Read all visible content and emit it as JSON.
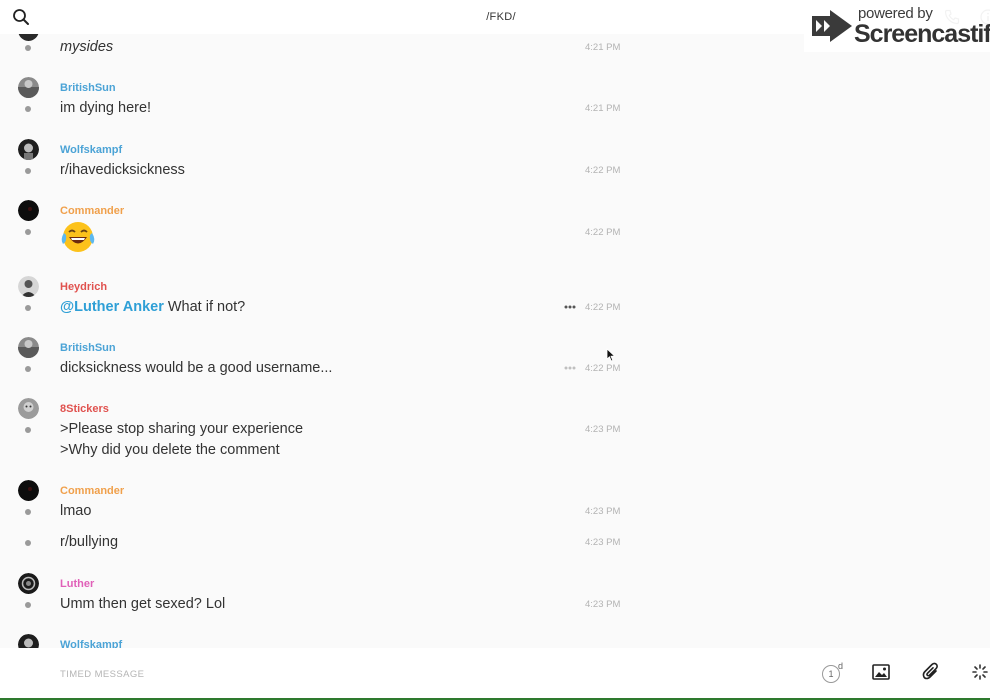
{
  "header": {
    "channel_title": "/FKD/"
  },
  "watermark": {
    "powered_by": "powered by",
    "brand": "Screencastify"
  },
  "colors": {
    "link_blue": "#4ba3d6",
    "commander_orange": "#f0a04b",
    "red_name": "#e0524f",
    "luther_pink": "#e060b8",
    "mention_blue": "#2e9fd6",
    "time_gray": "#b3b3b3"
  },
  "messages": [
    {
      "text": "mysides",
      "time": "4:21 PM"
    },
    {
      "sender": "BritishSun",
      "text": "im dying here!",
      "time": "4:21 PM"
    },
    {
      "sender": "Wolfskampf",
      "text": "r/ihavedicksickness",
      "time": "4:22 PM"
    },
    {
      "sender": "Commander",
      "emoji": "face-with-tears-of-joy",
      "time": "4:22 PM"
    },
    {
      "sender": "Heydrich",
      "mention": "@Luther Anker",
      "text": " What if not?",
      "time": "4:22 PM"
    },
    {
      "sender": "BritishSun",
      "text": "dicksickness would be a good username...",
      "time": "4:22 PM"
    },
    {
      "sender": "8Stickers",
      "text": ">Please stop sharing your experience",
      "text2": ">Why did you delete the comment",
      "time": "4:23 PM"
    },
    {
      "sender": "Commander",
      "text": "lmao",
      "time": "4:23 PM"
    },
    {
      "text": "r/bullying",
      "time": "4:23 PM"
    },
    {
      "sender": "Luther",
      "text": "Umm then get sexed? Lol",
      "time": "4:23 PM"
    },
    {
      "sender": "Wolfskampf"
    }
  ],
  "composer": {
    "placeholder": "TIMED MESSAGE",
    "value": "",
    "timer_value": "1",
    "timer_unit": "d"
  },
  "icons": {
    "search": "search-icon",
    "phone": "phone-icon",
    "info": "info-icon",
    "more": "more-horizontal-icon",
    "image": "image-icon",
    "attach": "paperclip-icon",
    "loading": "spinner-icon",
    "timer": "timer-icon"
  }
}
